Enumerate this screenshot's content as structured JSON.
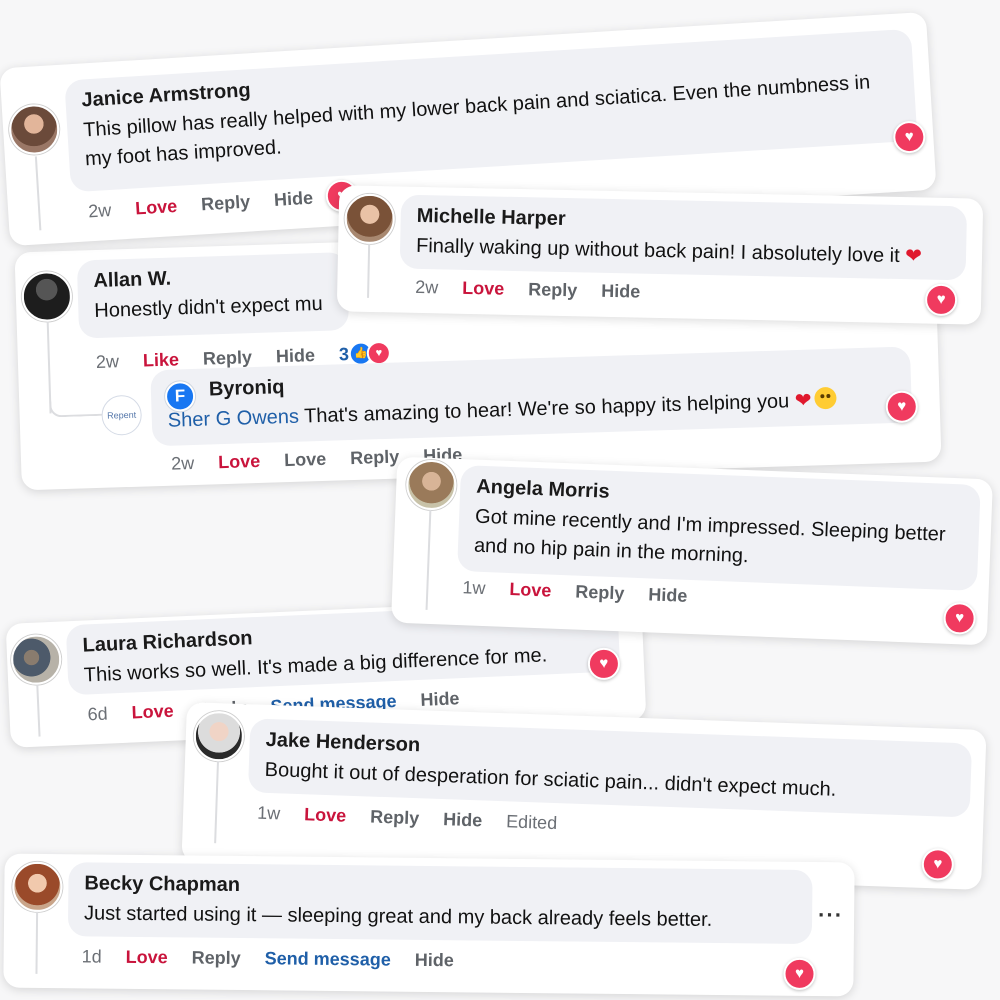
{
  "comments": [
    {
      "name": "Janice Armstrong",
      "text": "This pillow has really helped with my lower back pain and sciatica. Even the numbness in my foot has improved.",
      "time": "2w",
      "reaction_label": "Love",
      "reply_label": "Reply",
      "hide_label": "Hide"
    },
    {
      "name": "Michelle Harper",
      "text": "Finally waking up without back pain! I absolutely love it",
      "time": "2w",
      "reaction_label": "Love",
      "reply_label": "Reply",
      "hide_label": "Hide"
    },
    {
      "name": "Allan W.",
      "text": "Honestly didn't expect mu",
      "time": "2w",
      "reaction_label": "Like",
      "reply_label": "Reply",
      "hide_label": "Hide",
      "reaction_count": "3",
      "reply": {
        "name": "Byroniq",
        "mention": "Sher G Owens",
        "text": "That's amazing to hear! We're so happy its helping you",
        "time": "2w",
        "reaction_label": "Love",
        "love_label": "Love",
        "reply_label": "Reply",
        "hide_label": "Hide",
        "brand_initial": "F",
        "watermark": "Repent"
      }
    },
    {
      "name": "Angela Morris",
      "text": "Got mine recently and I'm impressed. Sleeping better and no hip pain in the morning.",
      "time": "1w",
      "reaction_label": "Love",
      "reply_label": "Reply",
      "hide_label": "Hide"
    },
    {
      "name": "Laura Richardson",
      "text": "This works so well. It's made a big difference for me.",
      "time": "6d",
      "reaction_label": "Love",
      "reply_label": "Reply",
      "send_label": "Send message",
      "hide_label": "Hide"
    },
    {
      "name": "Jake Henderson",
      "text": "Bought it out of desperation for sciatic pain... didn't expect much.",
      "time": "1w",
      "reaction_label": "Love",
      "reply_label": "Reply",
      "hide_label": "Hide",
      "edited_label": "Edited"
    },
    {
      "name": "Becky Chapman",
      "text": "Just started using it — sleeping great and my back already feels better.",
      "time": "1d",
      "reaction_label": "Love",
      "reply_label": "Reply",
      "send_label": "Send message",
      "hide_label": "Hide",
      "more_label": "···"
    }
  ],
  "icons": {
    "heart_glyph": "♥",
    "like_glyph": "👍",
    "inline_heart": "❤"
  },
  "colors": {
    "love": "#c9143c",
    "link": "#1f5fa8",
    "heart_badge": "#f03a5f",
    "bubble": "#f0f1f5"
  }
}
